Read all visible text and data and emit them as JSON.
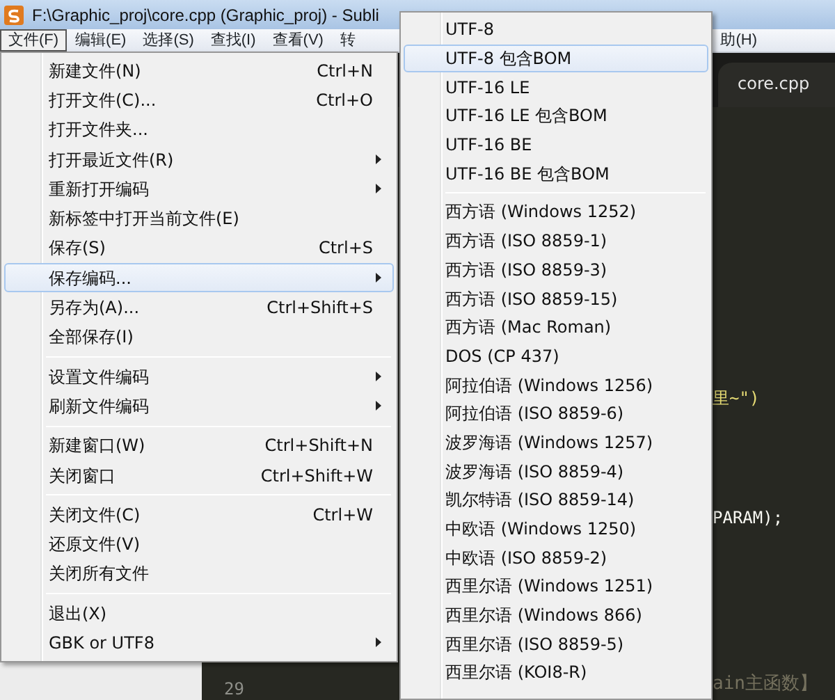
{
  "window": {
    "title": "F:\\Graphic_proj\\core.cpp (Graphic_proj) - Subli"
  },
  "menu_bar": [
    {
      "label": "文件(F)",
      "selected": true
    },
    {
      "label": "编辑(E)",
      "selected": false
    },
    {
      "label": "选择(S)",
      "selected": false
    },
    {
      "label": "查找(I)",
      "selected": false
    },
    {
      "label": "查看(V)",
      "selected": false
    },
    {
      "label": "转",
      "selected": false
    },
    {
      "label": "助(H)",
      "selected": false
    }
  ],
  "file_menu": {
    "items": [
      {
        "kind": "item",
        "label": "新建文件(N)",
        "shortcut": "Ctrl+N",
        "submenu": false,
        "selected": false
      },
      {
        "kind": "item",
        "label": "打开文件(C)...",
        "shortcut": "Ctrl+O",
        "submenu": false,
        "selected": false
      },
      {
        "kind": "item",
        "label": "打开文件夹...",
        "submenu": false,
        "selected": false
      },
      {
        "kind": "item",
        "label": "打开最近文件(R)",
        "submenu": true,
        "selected": false
      },
      {
        "kind": "item",
        "label": "重新打开编码",
        "submenu": true,
        "selected": false
      },
      {
        "kind": "item",
        "label": "新标签中打开当前文件(E)",
        "submenu": false,
        "selected": false
      },
      {
        "kind": "item",
        "label": "保存(S)",
        "shortcut": "Ctrl+S",
        "submenu": false,
        "selected": false
      },
      {
        "kind": "item",
        "label": "保存编码...",
        "submenu": true,
        "selected": true
      },
      {
        "kind": "item",
        "label": "另存为(A)...",
        "shortcut": "Ctrl+Shift+S",
        "submenu": false,
        "selected": false
      },
      {
        "kind": "item",
        "label": "全部保存(I)",
        "submenu": false,
        "selected": false
      },
      {
        "kind": "separator"
      },
      {
        "kind": "item",
        "label": "设置文件编码",
        "submenu": true,
        "selected": false
      },
      {
        "kind": "item",
        "label": "刷新文件编码",
        "submenu": true,
        "selected": false
      },
      {
        "kind": "separator"
      },
      {
        "kind": "item",
        "label": "新建窗口(W)",
        "shortcut": "Ctrl+Shift+N",
        "submenu": false,
        "selected": false
      },
      {
        "kind": "item",
        "label": "关闭窗口",
        "shortcut": "Ctrl+Shift+W",
        "submenu": false,
        "selected": false
      },
      {
        "kind": "separator"
      },
      {
        "kind": "item",
        "label": "关闭文件(C)",
        "shortcut": "Ctrl+W",
        "submenu": false,
        "selected": false
      },
      {
        "kind": "item",
        "label": "还原文件(V)",
        "submenu": false,
        "selected": false
      },
      {
        "kind": "item",
        "label": "关闭所有文件",
        "submenu": false,
        "selected": false
      },
      {
        "kind": "separator"
      },
      {
        "kind": "item",
        "label": "退出(X)",
        "submenu": false,
        "selected": false
      },
      {
        "kind": "item",
        "label": "GBK or UTF8",
        "submenu": true,
        "selected": false
      }
    ]
  },
  "encoding_submenu": {
    "items": [
      {
        "kind": "item",
        "label": "UTF-8",
        "selected": false
      },
      {
        "kind": "item",
        "label": "UTF-8 包含BOM",
        "selected": true
      },
      {
        "kind": "item",
        "label": "UTF-16 LE",
        "selected": false
      },
      {
        "kind": "item",
        "label": "UTF-16 LE 包含BOM",
        "selected": false
      },
      {
        "kind": "item",
        "label": "UTF-16 BE",
        "selected": false
      },
      {
        "kind": "item",
        "label": "UTF-16 BE 包含BOM",
        "selected": false
      },
      {
        "kind": "separator"
      },
      {
        "kind": "item",
        "label": "西方语 (Windows 1252)",
        "selected": false
      },
      {
        "kind": "item",
        "label": "西方语 (ISO 8859-1)",
        "selected": false
      },
      {
        "kind": "item",
        "label": "西方语 (ISO 8859-3)",
        "selected": false
      },
      {
        "kind": "item",
        "label": "西方语 (ISO 8859-15)",
        "selected": false
      },
      {
        "kind": "item",
        "label": "西方语 (Mac Roman)",
        "selected": false
      },
      {
        "kind": "item",
        "label": "DOS (CP 437)",
        "selected": false
      },
      {
        "kind": "item",
        "label": "阿拉伯语 (Windows 1256)",
        "selected": false
      },
      {
        "kind": "item",
        "label": "阿拉伯语 (ISO 8859-6)",
        "selected": false
      },
      {
        "kind": "item",
        "label": "波罗海语 (Windows 1257)",
        "selected": false
      },
      {
        "kind": "item",
        "label": "波罗海语 (ISO 8859-4)",
        "selected": false
      },
      {
        "kind": "item",
        "label": "凯尔特语 (ISO 8859-14)",
        "selected": false
      },
      {
        "kind": "item",
        "label": "中欧语 (Windows 1250)",
        "selected": false
      },
      {
        "kind": "item",
        "label": "中欧语 (ISO 8859-2)",
        "selected": false
      },
      {
        "kind": "item",
        "label": "西里尔语 (Windows 1251)",
        "selected": false
      },
      {
        "kind": "item",
        "label": "西里尔语 (Windows 866)",
        "selected": false
      },
      {
        "kind": "item",
        "label": "西里尔语 (ISO 8859-5)",
        "selected": false
      },
      {
        "kind": "item",
        "label": "西里尔语 (KOI8-R)",
        "selected": false
      }
    ]
  },
  "editor": {
    "tab": "core.cpp",
    "code_fragments": [
      "里~\")",
      "PARAM);",
      "ain主函数】"
    ],
    "line_numbers": [
      "29"
    ]
  }
}
